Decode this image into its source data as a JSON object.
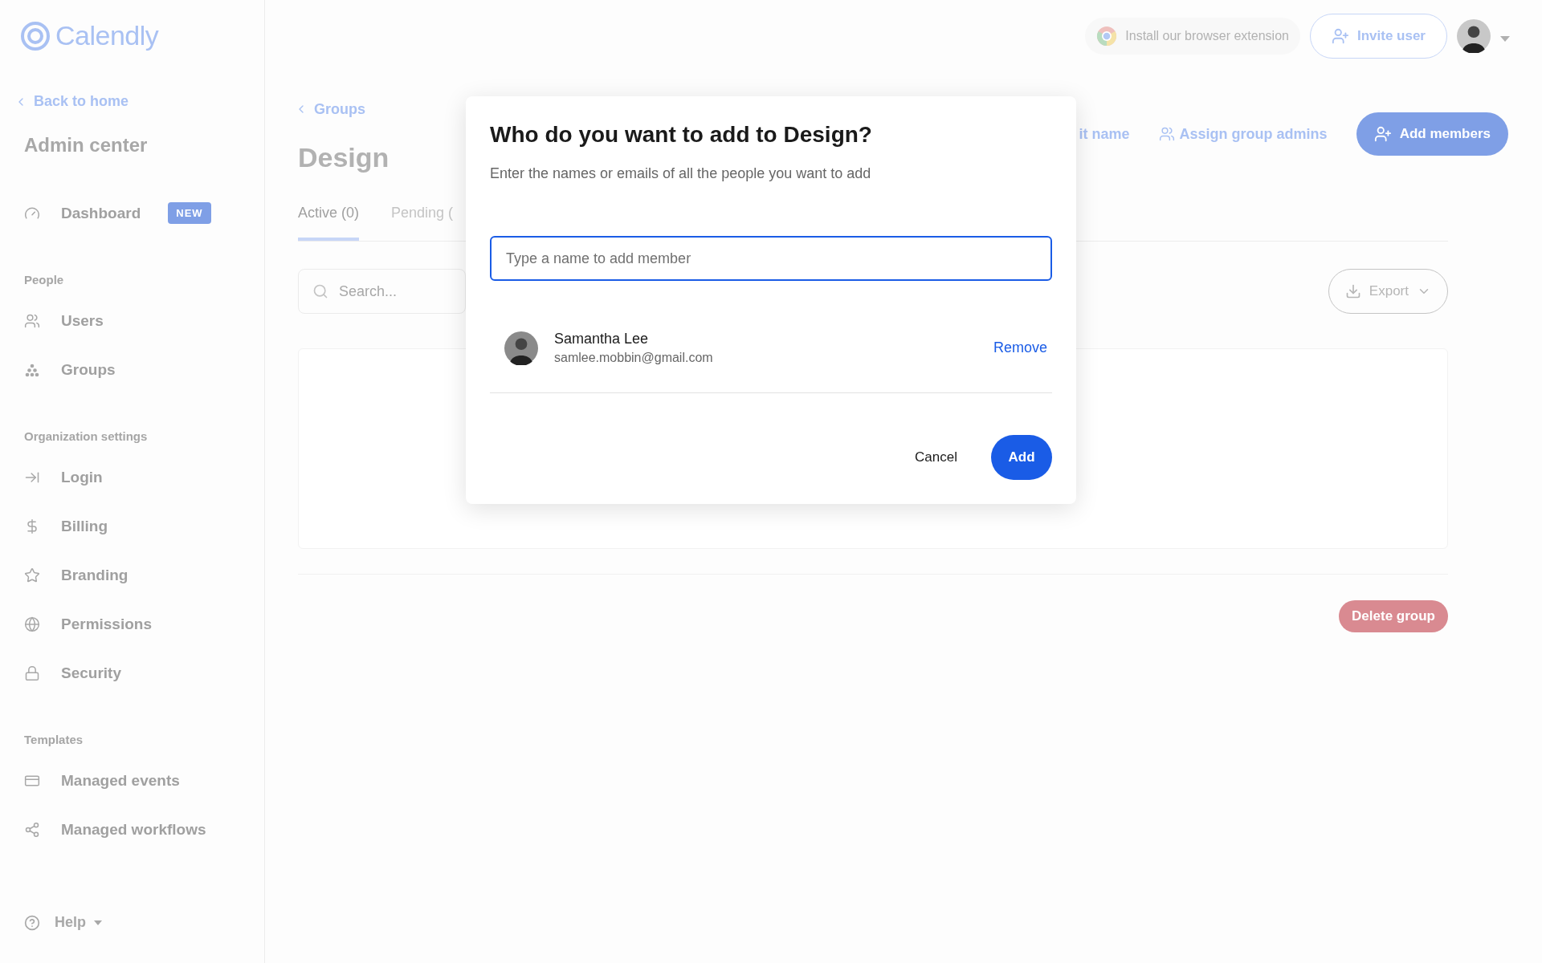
{
  "sidebar": {
    "logo": "Calendly",
    "back_link": "Back to home",
    "title": "Admin center",
    "sections": [
      {
        "items": [
          {
            "label": "Dashboard",
            "badge": "NEW"
          }
        ]
      },
      {
        "heading": "People",
        "items": [
          {
            "label": "Users"
          },
          {
            "label": "Groups"
          }
        ]
      },
      {
        "heading": "Organization settings",
        "items": [
          {
            "label": "Login"
          },
          {
            "label": "Billing"
          },
          {
            "label": "Branding"
          },
          {
            "label": "Permissions"
          },
          {
            "label": "Security"
          }
        ]
      },
      {
        "heading": "Templates",
        "items": [
          {
            "label": "Managed events"
          },
          {
            "label": "Managed workflows"
          }
        ]
      }
    ],
    "help": "Help"
  },
  "header": {
    "extension": "Install our browser extension",
    "invite": "Invite user"
  },
  "page": {
    "breadcrumb": "Groups",
    "title": "Design",
    "actions": [
      {
        "label": "it name"
      },
      {
        "label": "Assign group admins"
      }
    ],
    "add_members": "Add members",
    "tabs": [
      {
        "label": "Active (0)",
        "selected": true
      },
      {
        "label": "Pending (",
        "selected": false
      }
    ],
    "search": {
      "placeholder": "Search..."
    },
    "export": "Export",
    "delete": "Delete group"
  },
  "modal": {
    "title": "Who do you want to add to Design?",
    "subtitle": "Enter the names or emails of all the people you want to add",
    "input": {
      "placeholder": "Type a name to add member"
    },
    "members": [
      {
        "name": "Samantha Lee",
        "email": "samlee.mobbin@gmail.com",
        "action": "Remove"
      }
    ],
    "cancel": "Cancel",
    "confirm": "Add"
  }
}
